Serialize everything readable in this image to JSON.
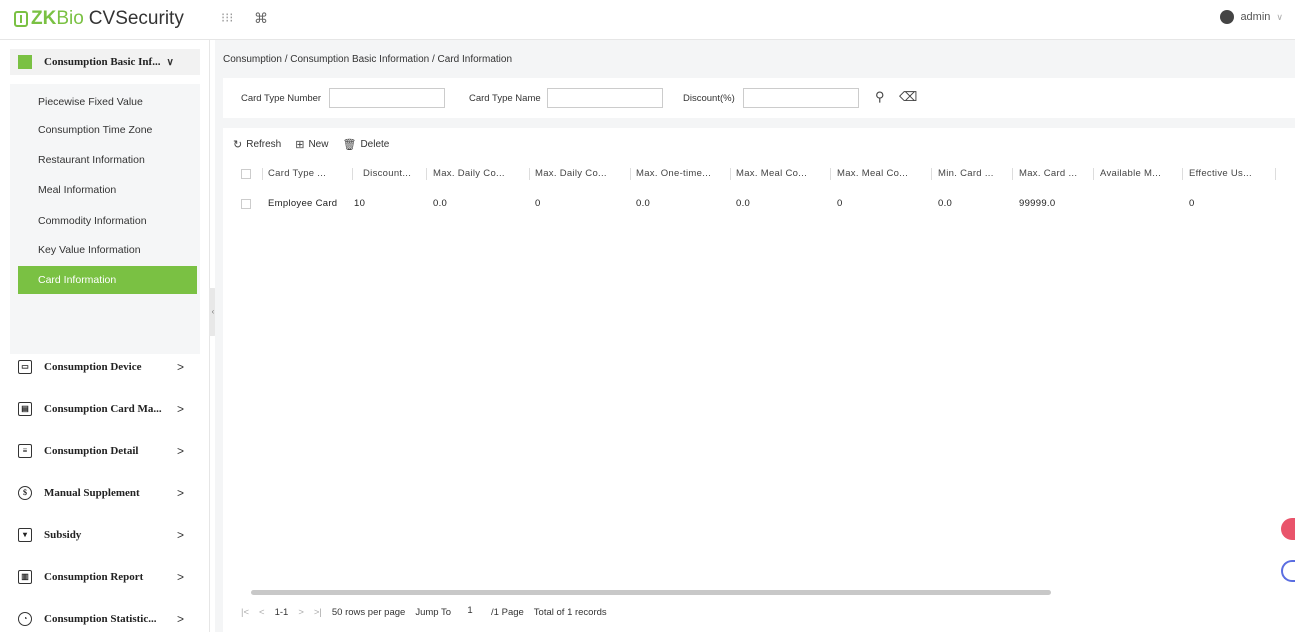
{
  "app": {
    "title_zk": "ZK",
    "title_bio": "Bio",
    "title_product": "CVSecurity",
    "user": "admin"
  },
  "sidebar": {
    "header": "Consumption Basic Inf...",
    "submenu": [
      "Piecewise Fixed Value",
      "Consumption Time Zone",
      "Restaurant Information",
      "Meal Information",
      "Commodity Information",
      "Key Value Information",
      "Card Information"
    ],
    "active_index": 6,
    "menus": [
      {
        "label": "Consumption Device",
        "icon": "monitor-icon"
      },
      {
        "label": "Consumption Card Ma...",
        "icon": "card-icon"
      },
      {
        "label": "Consumption Detail",
        "icon": "detail-icon"
      },
      {
        "label": "Manual Supplement",
        "icon": "supplement-icon"
      },
      {
        "label": "Subsidy",
        "icon": "subsidy-icon"
      },
      {
        "label": "Consumption Report",
        "icon": "report-icon"
      },
      {
        "label": "Consumption Statistic...",
        "icon": "statistic-icon"
      }
    ]
  },
  "breadcrumb": "Consumption / Consumption Basic Information / Card Information",
  "filters": {
    "card_type_number": {
      "label": "Card Type Number",
      "value": ""
    },
    "card_type_name": {
      "label": "Card Type Name",
      "value": ""
    },
    "discount": {
      "label": "Discount(%)",
      "value": ""
    }
  },
  "toolbar": {
    "refresh": "Refresh",
    "new": "New",
    "delete": "Delete"
  },
  "table": {
    "columns": [
      "Card Type ...",
      "Discount...",
      "Max. Daily Co...",
      "Max. Daily Co...",
      "Max. One-time...",
      "Max. Meal Co...",
      "Max. Meal Co...",
      "Min. Card ...",
      "Max. Card ...",
      "Available M...",
      "Effective Us..."
    ],
    "rows": [
      [
        "Employee Card",
        "10",
        "0.0",
        "0",
        "0.0",
        "0.0",
        "0",
        "0.0",
        "99999.0",
        "",
        "0"
      ]
    ]
  },
  "pager": {
    "range": "1-1",
    "rows_per_page": "50 rows per page",
    "jump_label": "Jump To",
    "jump_value": "1",
    "page_total": "/1 Page",
    "total": "Total of 1 records"
  },
  "colors": {
    "accent": "#7ac143",
    "background": "#f4f5f6"
  }
}
